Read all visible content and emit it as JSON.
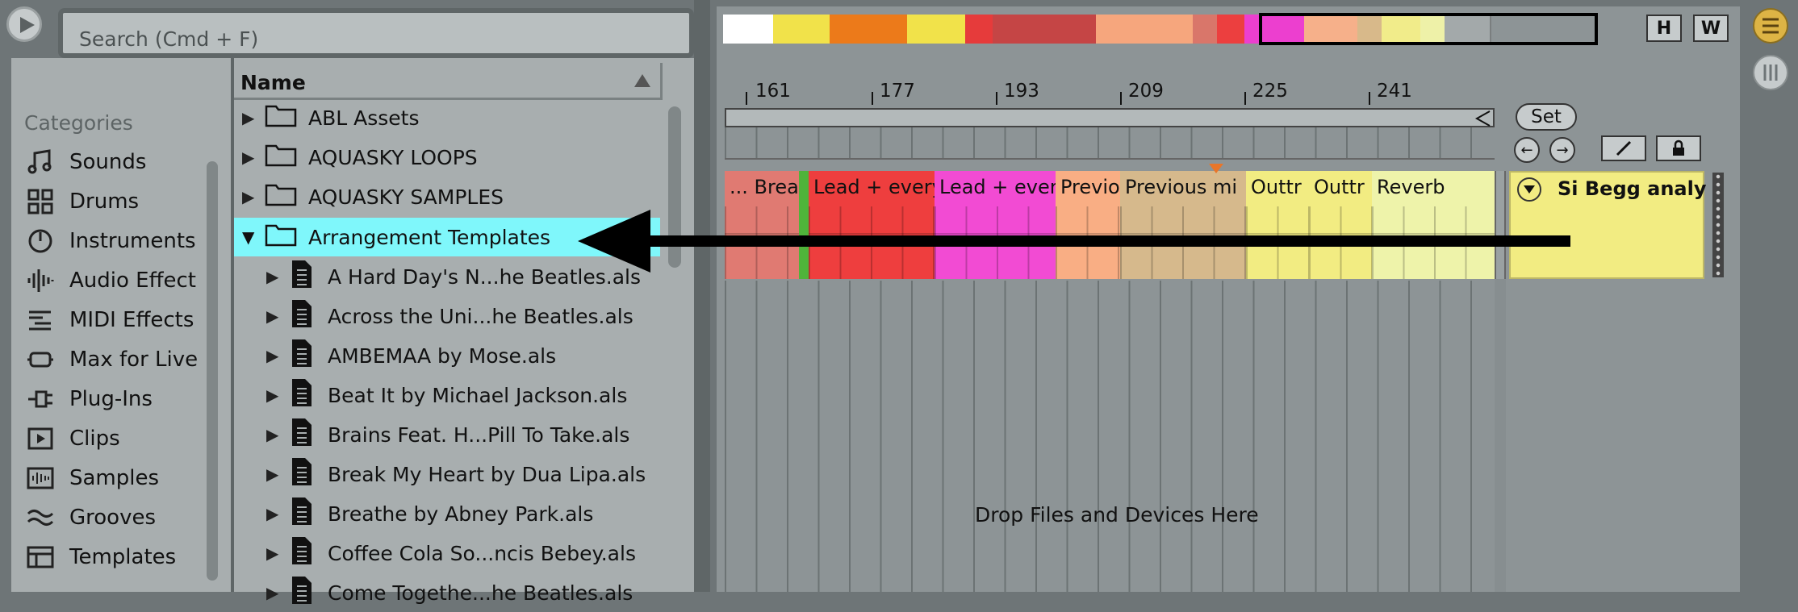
{
  "search": {
    "placeholder": "Search (Cmd + F)"
  },
  "categories": {
    "title": "Categories",
    "items": [
      {
        "label": "Sounds",
        "icon": "note-icon"
      },
      {
        "label": "Drums",
        "icon": "drum-pads-icon"
      },
      {
        "label": "Instruments",
        "icon": "instrument-icon"
      },
      {
        "label": "Audio Effect",
        "icon": "audio-effect-icon"
      },
      {
        "label": "MIDI Effects",
        "icon": "midi-effects-icon"
      },
      {
        "label": "Max for Live",
        "icon": "max-for-live-icon"
      },
      {
        "label": "Plug-Ins",
        "icon": "plug-icon"
      },
      {
        "label": "Clips",
        "icon": "clip-icon"
      },
      {
        "label": "Samples",
        "icon": "samples-icon"
      },
      {
        "label": "Grooves",
        "icon": "groove-icon"
      },
      {
        "label": "Templates",
        "icon": "templates-icon"
      }
    ]
  },
  "file_browser": {
    "column_header": "Name",
    "folders": [
      {
        "label": "ABL Assets",
        "expanded": false
      },
      {
        "label": "AQUASKY LOOPS",
        "expanded": false
      },
      {
        "label": "AQUASKY SAMPLES",
        "expanded": false
      },
      {
        "label": "Arrangement Templates",
        "expanded": true,
        "selected": true
      }
    ],
    "files": [
      "A Hard Day's N...he Beatles.als",
      "Across the Uni...he Beatles.als",
      "AMBEMAA by Mose.als",
      "Beat It by Michael Jackson.als",
      "Brains Feat. H...Pill To Take.als",
      "Break My Heart by Dua Lipa.als",
      "Breathe by Abney Park.als",
      "Coffee Cola So...ncis Bebey.als",
      "Come Togethe...he Beatles.als"
    ]
  },
  "arrangement": {
    "overview_colors": [
      "#ffffff",
      "#f1e24a",
      "#ec7a1a",
      "#f1e24a",
      "#e63b3b",
      "#c54545",
      "#c54545",
      "#f6a67d",
      "#d9766a",
      "#ec3f3f",
      "#ec3fcf",
      "#f6b08a",
      "#d8b98a",
      "#f1ec8a",
      "#eef1a8",
      "#a3a9aa"
    ],
    "buttons": {
      "h": "H",
      "w": "W",
      "set": "Set"
    },
    "ruler": [
      "161",
      "177",
      "193",
      "209",
      "225",
      "241"
    ],
    "clips": [
      {
        "name": "... Brea",
        "color": "#e07a72"
      },
      {
        "name": "Lead + every",
        "color": "#ee3e3e"
      },
      {
        "name": "Lead + ever",
        "color": "#f24bd3"
      },
      {
        "name": "Previo",
        "color": "#f9ae84"
      },
      {
        "name": "Previous mi",
        "color": "#d6b98c"
      },
      {
        "name": "Outtr",
        "color": "#f2ec82"
      },
      {
        "name": "Outtr",
        "color": "#f2ec82"
      },
      {
        "name": "Reverb",
        "color": "#eef3aa"
      }
    ],
    "track_name": "Si Begg analy",
    "drop_hint": "Drop Files and Devices Here"
  }
}
